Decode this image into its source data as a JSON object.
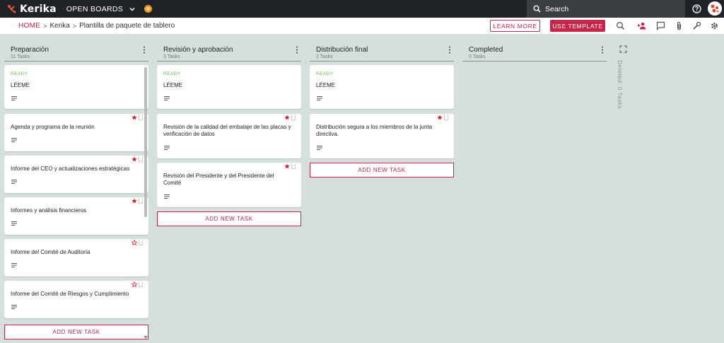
{
  "app": {
    "logo": "Kerika",
    "open_boards": "OPEN BOARDS"
  },
  "search": {
    "placeholder": "Search"
  },
  "breadcrumb": {
    "home": "HOME",
    "org": "Kerika",
    "board": "Plantilla de paquete de tablero"
  },
  "toolbar": {
    "learn_more": "LEARN MORE",
    "use_template": "USE TEMPLATE"
  },
  "colors": {
    "accent": "#c8244a",
    "ready": "#6ab04c",
    "background": "#d5dfdb",
    "topbar": "#1f2226"
  },
  "columns": [
    {
      "title": "Preparación",
      "count": "11 Tasks",
      "cards": [
        {
          "status": "READY",
          "title": "LÉEME",
          "star": "none"
        },
        {
          "status": "",
          "title": "Agenda y programa de la reunión",
          "star": "filled"
        },
        {
          "status": "",
          "title": "Informe del CEO y actualizaciones estratégicas",
          "star": "filled"
        },
        {
          "status": "",
          "title": "Informes y análisis financieros",
          "star": "filled"
        },
        {
          "status": "",
          "title": "Informe del Comité de Auditoría",
          "star": "outline"
        },
        {
          "status": "",
          "title": "Informe del Comité de Riesgos y Cumplimiento",
          "star": "outline"
        }
      ],
      "add_label": "ADD NEW TASK"
    },
    {
      "title": "Revisión y aprobación",
      "count": "3 Tasks",
      "cards": [
        {
          "status": "READY",
          "title": "LÉEME",
          "star": "none"
        },
        {
          "status": "",
          "title": "Revisión de la calidad del embalaje de las placas y verificación de datos",
          "star": "filled"
        },
        {
          "status": "",
          "title": "Revisión del Presidente y del Presidente del Comité",
          "star": "filled"
        }
      ],
      "add_label": "ADD NEW TASK"
    },
    {
      "title": "Distribución final",
      "count": "2 Tasks",
      "cards": [
        {
          "status": "READY",
          "title": "LÉEME",
          "star": "none"
        },
        {
          "status": "",
          "title": "Distribución segura a los miembros de la junta directiva.",
          "star": "filled"
        }
      ],
      "add_label": "ADD NEW TASK"
    },
    {
      "title": "Completed",
      "count": "0 Tasks",
      "cards": []
    }
  ],
  "deleted": "Deleted: 0 Tasks"
}
